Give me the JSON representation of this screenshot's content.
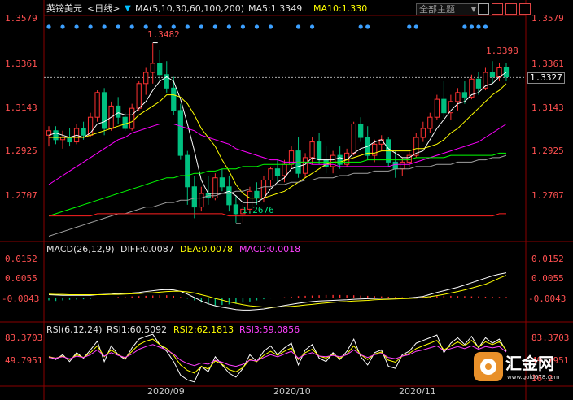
{
  "header": {
    "symbol": "英镑美元",
    "period_tab": "<日线>",
    "ma_label": "MA(5,10,30,60,100,200)",
    "ma5_label": "MA5:1.3349",
    "ma10_label": "MA10:1.330",
    "theme_select": "全部主题",
    "icons": [
      "square-grid-icon",
      "panel-icon",
      "single-panel-icon",
      "multi-panel-icon"
    ]
  },
  "price_panel": {
    "y_ticks": [
      "1.3579",
      "1.3361",
      "1.3143",
      "1.2925",
      "1.2707"
    ],
    "current_price": "1.3327",
    "high_label": "1.3482",
    "recent_high_label": "1.3398",
    "low_label": "1.2676"
  },
  "macd_panel": {
    "title": "MACD(26,12,9)",
    "diff": "DIFF:0.0087",
    "dea": "DEA:0.0078",
    "macd": "MACD:0.0018",
    "y_ticks": [
      "0.0152",
      "0.0055",
      "-0.0043"
    ]
  },
  "rsi_panel": {
    "title": "RSI(6,12,24)",
    "rsi1": "RSI1:60.5092",
    "rsi2": "RSI2:62.1813",
    "rsi3": "RSI3:59.0856",
    "y_ticks": [
      "83.3703",
      "49.7951"
    ],
    "y_tick_right_partial": "16.2"
  },
  "x_axis": {
    "labels": [
      "2020/09",
      "2020/10",
      "2020/11"
    ]
  },
  "watermark": {
    "name": "汇金网",
    "url": "www.gold678.com"
  },
  "colors": {
    "up": "#ff3232",
    "down": "#00c080",
    "ma5": "#ffffff",
    "ma10": "#ffff00",
    "ma30": "#ff00ff",
    "ma60": "#00ff00",
    "ma100": "#a0a0a0",
    "ma200": "#ff2020",
    "dots": "#3ca0ff"
  },
  "chart_data": {
    "type": "candlestick",
    "candles": [
      [
        1.307,
        1.311,
        1.302,
        1.309
      ],
      [
        1.309,
        1.311,
        1.303,
        1.305
      ],
      [
        1.305,
        1.309,
        1.301,
        1.306
      ],
      [
        1.306,
        1.31,
        1.302,
        1.304
      ],
      [
        1.304,
        1.312,
        1.303,
        1.31
      ],
      [
        1.31,
        1.313,
        1.305,
        1.307
      ],
      [
        1.307,
        1.317,
        1.306,
        1.315
      ],
      [
        1.315,
        1.327,
        1.313,
        1.326
      ],
      [
        1.326,
        1.328,
        1.307,
        1.31
      ],
      [
        1.31,
        1.322,
        1.309,
        1.32
      ],
      [
        1.32,
        1.324,
        1.312,
        1.315
      ],
      [
        1.315,
        1.317,
        1.309,
        1.31
      ],
      [
        1.31,
        1.321,
        1.309,
        1.319
      ],
      [
        1.319,
        1.331,
        1.318,
        1.33
      ],
      [
        1.33,
        1.337,
        1.325,
        1.335
      ],
      [
        1.335,
        1.348,
        1.33,
        1.339
      ],
      [
        1.339,
        1.345,
        1.331,
        1.334
      ],
      [
        1.334,
        1.34,
        1.326,
        1.328
      ],
      [
        1.328,
        1.333,
        1.316,
        1.318
      ],
      [
        1.318,
        1.321,
        1.296,
        1.298
      ],
      [
        1.298,
        1.3,
        1.276,
        1.284
      ],
      [
        1.284,
        1.289,
        1.27,
        1.275
      ],
      [
        1.275,
        1.284,
        1.273,
        1.281
      ],
      [
        1.281,
        1.289,
        1.276,
        1.279
      ],
      [
        1.279,
        1.29,
        1.278,
        1.288
      ],
      [
        1.288,
        1.292,
        1.282,
        1.284
      ],
      [
        1.284,
        1.289,
        1.273,
        1.276
      ],
      [
        1.276,
        1.28,
        1.268,
        1.272
      ],
      [
        1.272,
        1.276,
        1.268,
        1.274
      ],
      [
        1.274,
        1.284,
        1.272,
        1.282
      ],
      [
        1.282,
        1.286,
        1.276,
        1.279
      ],
      [
        1.279,
        1.289,
        1.277,
        1.287
      ],
      [
        1.287,
        1.293,
        1.284,
        1.292
      ],
      [
        1.292,
        1.296,
        1.286,
        1.289
      ],
      [
        1.289,
        1.296,
        1.286,
        1.294
      ],
      [
        1.294,
        1.302,
        1.292,
        1.3
      ],
      [
        1.3,
        1.306,
        1.288,
        1.29
      ],
      [
        1.29,
        1.299,
        1.288,
        1.297
      ],
      [
        1.297,
        1.306,
        1.294,
        1.304
      ],
      [
        1.304,
        1.308,
        1.294,
        1.296
      ],
      [
        1.296,
        1.302,
        1.29,
        1.293
      ],
      [
        1.293,
        1.3,
        1.29,
        1.298
      ],
      [
        1.298,
        1.302,
        1.292,
        1.294
      ],
      [
        1.294,
        1.301,
        1.293,
        1.299
      ],
      [
        1.299,
        1.313,
        1.298,
        1.312
      ],
      [
        1.312,
        1.315,
        1.304,
        1.306
      ],
      [
        1.306,
        1.311,
        1.296,
        1.298
      ],
      [
        1.298,
        1.305,
        1.295,
        1.303
      ],
      [
        1.303,
        1.307,
        1.3,
        1.305
      ],
      [
        1.305,
        1.306,
        1.293,
        1.295
      ],
      [
        1.295,
        1.3,
        1.288,
        1.292
      ],
      [
        1.292,
        1.297,
        1.289,
        1.295
      ],
      [
        1.295,
        1.3,
        1.293,
        1.298
      ],
      [
        1.298,
        1.308,
        1.297,
        1.306
      ],
      [
        1.306,
        1.313,
        1.304,
        1.31
      ],
      [
        1.31,
        1.317,
        1.308,
        1.315
      ],
      [
        1.315,
        1.325,
        1.314,
        1.323
      ],
      [
        1.323,
        1.331,
        1.315,
        1.317
      ],
      [
        1.317,
        1.325,
        1.314,
        1.322
      ],
      [
        1.322,
        1.328,
        1.318,
        1.326
      ],
      [
        1.326,
        1.331,
        1.321,
        1.324
      ],
      [
        1.324,
        1.334,
        1.323,
        1.332
      ],
      [
        1.332,
        1.335,
        1.325,
        1.328
      ],
      [
        1.328,
        1.337,
        1.327,
        1.335
      ],
      [
        1.335,
        1.34,
        1.33,
        1.333
      ],
      [
        1.333,
        1.339,
        1.331,
        1.337
      ],
      [
        1.337,
        1.339,
        1.331,
        1.333
      ]
    ],
    "ma_series": [
      {
        "name": "MA5",
        "values": [
          1.307,
          1.308,
          1.307,
          1.306,
          1.307,
          1.306,
          1.308,
          1.312,
          1.313,
          1.315,
          1.317,
          1.316,
          1.316,
          1.319,
          1.322,
          1.327,
          1.331,
          1.333,
          1.331,
          1.323,
          1.312,
          1.3,
          1.287,
          1.281,
          1.281,
          1.281,
          1.282,
          1.28,
          1.277,
          1.277,
          1.277,
          1.279,
          1.283,
          1.286,
          1.288,
          1.292,
          1.293,
          1.294,
          1.297,
          1.296,
          1.296,
          1.296,
          1.297,
          1.296,
          1.299,
          1.301,
          1.302,
          1.304,
          1.305,
          1.301,
          1.299,
          1.297,
          1.297,
          1.299,
          1.3,
          1.305,
          1.31,
          1.314,
          1.318,
          1.321,
          1.322,
          1.325,
          1.326,
          1.329,
          1.33,
          1.333,
          1.335
        ]
      },
      {
        "name": "MA10",
        "values": [
          1.306,
          1.306,
          1.306,
          1.306,
          1.306,
          1.306,
          1.307,
          1.308,
          1.309,
          1.31,
          1.311,
          1.312,
          1.313,
          1.316,
          1.318,
          1.32,
          1.322,
          1.325,
          1.325,
          1.324,
          1.321,
          1.316,
          1.31,
          1.306,
          1.302,
          1.296,
          1.291,
          1.285,
          1.281,
          1.279,
          1.279,
          1.279,
          1.28,
          1.281,
          1.282,
          1.284,
          1.286,
          1.288,
          1.29,
          1.292,
          1.294,
          1.295,
          1.295,
          1.296,
          1.297,
          1.298,
          1.299,
          1.299,
          1.3,
          1.3,
          1.3,
          1.3,
          1.3,
          1.301,
          1.301,
          1.302,
          1.303,
          1.305,
          1.308,
          1.31,
          1.313,
          1.316,
          1.319,
          1.322,
          1.325,
          1.327,
          1.33
        ]
      },
      {
        "name": "MA30",
        "values": [
          1.285,
          1.287,
          1.289,
          1.291,
          1.293,
          1.295,
          1.297,
          1.299,
          1.301,
          1.303,
          1.305,
          1.306,
          1.308,
          1.309,
          1.31,
          1.311,
          1.312,
          1.312,
          1.312,
          1.311,
          1.31,
          1.309,
          1.307,
          1.306,
          1.305,
          1.304,
          1.303,
          1.301,
          1.3,
          1.299,
          1.298,
          1.297,
          1.296,
          1.296,
          1.295,
          1.295,
          1.295,
          1.295,
          1.294,
          1.294,
          1.294,
          1.294,
          1.293,
          1.293,
          1.293,
          1.293,
          1.293,
          1.293,
          1.293,
          1.293,
          1.294,
          1.294,
          1.294,
          1.295,
          1.296,
          1.297,
          1.298,
          1.299,
          1.3,
          1.301,
          1.302,
          1.303,
          1.304,
          1.306,
          1.308,
          1.31,
          1.312
        ]
      },
      {
        "name": "MA60",
        "values": [
          1.271,
          1.272,
          1.273,
          1.274,
          1.275,
          1.276,
          1.277,
          1.278,
          1.279,
          1.28,
          1.281,
          1.282,
          1.283,
          1.284,
          1.285,
          1.286,
          1.287,
          1.288,
          1.288,
          1.289,
          1.289,
          1.29,
          1.29,
          1.291,
          1.291,
          1.292,
          1.292,
          1.292,
          1.293,
          1.293,
          1.293,
          1.294,
          1.294,
          1.294,
          1.294,
          1.294,
          1.295,
          1.295,
          1.295,
          1.295,
          1.295,
          1.295,
          1.295,
          1.295,
          1.295,
          1.295,
          1.296,
          1.296,
          1.296,
          1.296,
          1.296,
          1.296,
          1.296,
          1.297,
          1.297,
          1.297,
          1.297,
          1.297,
          1.298,
          1.298,
          1.298,
          1.298,
          1.298,
          1.298,
          1.298,
          1.299,
          1.299
        ]
      },
      {
        "name": "MA100",
        "values": [
          1.262,
          1.263,
          1.264,
          1.265,
          1.266,
          1.267,
          1.268,
          1.269,
          1.27,
          1.271,
          1.272,
          1.272,
          1.273,
          1.274,
          1.275,
          1.275,
          1.276,
          1.277,
          1.277,
          1.278,
          1.278,
          1.279,
          1.279,
          1.28,
          1.28,
          1.281,
          1.281,
          1.282,
          1.282,
          1.283,
          1.283,
          1.284,
          1.284,
          1.285,
          1.285,
          1.286,
          1.286,
          1.287,
          1.287,
          1.288,
          1.288,
          1.288,
          1.289,
          1.289,
          1.29,
          1.29,
          1.29,
          1.291,
          1.291,
          1.291,
          1.292,
          1.292,
          1.292,
          1.293,
          1.293,
          1.293,
          1.294,
          1.294,
          1.294,
          1.295,
          1.295,
          1.295,
          1.296,
          1.296,
          1.297,
          1.297,
          1.298
        ]
      },
      {
        "name": "MA200",
        "values": [
          1.271,
          1.271,
          1.271,
          1.271,
          1.271,
          1.271,
          1.271,
          1.272,
          1.272,
          1.272,
          1.272,
          1.272,
          1.272,
          1.272,
          1.272,
          1.272,
          1.272,
          1.272,
          1.272,
          1.272,
          1.272,
          1.272,
          1.272,
          1.272,
          1.272,
          1.272,
          1.271,
          1.271,
          1.271,
          1.271,
          1.271,
          1.271,
          1.271,
          1.271,
          1.271,
          1.271,
          1.271,
          1.271,
          1.271,
          1.271,
          1.271,
          1.271,
          1.271,
          1.271,
          1.271,
          1.271,
          1.271,
          1.271,
          1.271,
          1.271,
          1.271,
          1.271,
          1.271,
          1.271,
          1.271,
          1.271,
          1.271,
          1.271,
          1.271,
          1.271,
          1.271,
          1.271,
          1.271,
          1.271,
          1.271,
          1.272,
          1.272
        ]
      }
    ],
    "macd_hist": [
      -0.001,
      -0.0012,
      -0.001,
      -0.0008,
      -0.0007,
      -0.0006,
      -0.0005,
      -0.0003,
      -0.0002,
      0.0,
      0.0002,
      0.0003,
      0.0004,
      0.0005,
      0.0006,
      0.0007,
      0.0008,
      0.0008,
      0.0006,
      0.0002,
      -0.0004,
      -0.001,
      -0.0018,
      -0.0024,
      -0.0027,
      -0.0026,
      -0.0024,
      -0.0022,
      -0.0018,
      -0.0014,
      -0.001,
      -0.0006,
      -0.0003,
      -0.0001,
      0.0001,
      0.0003,
      0.0005,
      0.0006,
      0.0007,
      0.0008,
      0.0009,
      0.0009,
      0.0009,
      0.0008,
      0.0008,
      0.0007,
      0.0006,
      0.0005,
      0.0004,
      0.0003,
      0.0002,
      0.0001,
      0.0001,
      0.0002,
      0.0003,
      0.0004,
      0.0005,
      0.0006,
      0.0006,
      0.0005,
      0.0005,
      0.0004,
      0.0004,
      0.0003,
      0.0003,
      0.0002,
      0.0002
    ],
    "macd_diff": [
      0.001,
      0.0009,
      0.0008,
      0.0008,
      0.0008,
      0.0008,
      0.0008,
      0.001,
      0.0011,
      0.0012,
      0.0014,
      0.0015,
      0.0016,
      0.0018,
      0.0021,
      0.0024,
      0.0027,
      0.0028,
      0.0027,
      0.0022,
      0.0012,
      0.0,
      -0.0012,
      -0.0022,
      -0.0029,
      -0.0034,
      -0.0038,
      -0.0042,
      -0.0044,
      -0.0044,
      -0.0042,
      -0.004,
      -0.0036,
      -0.0032,
      -0.0028,
      -0.0024,
      -0.002,
      -0.0017,
      -0.0014,
      -0.0012,
      -0.0011,
      -0.001,
      -0.0009,
      -0.0008,
      -0.0006,
      -0.0005,
      -0.0004,
      -0.0003,
      -0.0002,
      -0.0002,
      -0.0002,
      -0.0002,
      -0.0001,
      0.0001,
      0.0004,
      0.0011,
      0.0018,
      0.0024,
      0.003,
      0.0036,
      0.0044,
      0.0052,
      0.006,
      0.0068,
      0.0076,
      0.0082,
      0.0087
    ],
    "macd_dea": [
      0.0012,
      0.0011,
      0.0011,
      0.001,
      0.001,
      0.001,
      0.001,
      0.001,
      0.001,
      0.0011,
      0.0011,
      0.0012,
      0.0013,
      0.0014,
      0.0016,
      0.0017,
      0.0019,
      0.0021,
      0.0022,
      0.0022,
      0.002,
      0.0016,
      0.001,
      0.0004,
      -0.0003,
      -0.0009,
      -0.0015,
      -0.002,
      -0.0025,
      -0.0029,
      -0.0031,
      -0.0033,
      -0.0034,
      -0.0033,
      -0.0032,
      -0.0031,
      -0.0029,
      -0.0026,
      -0.0024,
      -0.0021,
      -0.0019,
      -0.0017,
      -0.0015,
      -0.0014,
      -0.0012,
      -0.0011,
      -0.001,
      -0.0008,
      -0.0007,
      -0.0006,
      -0.0005,
      -0.0004,
      -0.0003,
      -0.0002,
      0.0,
      0.0003,
      0.0007,
      0.0011,
      0.0016,
      0.0021,
      0.0027,
      0.0033,
      0.004,
      0.0047,
      0.0057,
      0.0068,
      0.0078
    ],
    "rsi_series": [
      {
        "name": "RSI1",
        "values": [
          52,
          48,
          55,
          45,
          58,
          50,
          62,
          75,
          45,
          68,
          55,
          48,
          65,
          78,
          82,
          85,
          70,
          60,
          45,
          25,
          18,
          15,
          38,
          30,
          52,
          40,
          28,
          22,
          35,
          55,
          45,
          60,
          68,
          55,
          65,
          72,
          40,
          62,
          70,
          50,
          45,
          58,
          48,
          60,
          78,
          52,
          40,
          58,
          62,
          38,
          35,
          55,
          60,
          72,
          76,
          80,
          84,
          58,
          72,
          80,
          70,
          82,
          65,
          80,
          72,
          78,
          60
        ]
      },
      {
        "name": "RSI2",
        "values": [
          52,
          50,
          53,
          48,
          55,
          51,
          58,
          68,
          52,
          62,
          55,
          50,
          60,
          70,
          75,
          78,
          70,
          64,
          54,
          40,
          32,
          28,
          38,
          34,
          46,
          41,
          33,
          30,
          36,
          48,
          45,
          54,
          60,
          54,
          60,
          65,
          48,
          58,
          63,
          53,
          50,
          55,
          50,
          56,
          68,
          55,
          48,
          56,
          59,
          47,
          44,
          53,
          57,
          64,
          68,
          72,
          76,
          62,
          68,
          74,
          68,
          76,
          66,
          74,
          70,
          74,
          62
        ]
      },
      {
        "name": "RSI3",
        "values": [
          51,
          50,
          52,
          49,
          53,
          51,
          55,
          62,
          53,
          58,
          54,
          51,
          56,
          63,
          67,
          70,
          66,
          62,
          56,
          47,
          42,
          39,
          43,
          41,
          47,
          44,
          40,
          38,
          41,
          47,
          46,
          51,
          55,
          52,
          56,
          60,
          50,
          55,
          58,
          53,
          52,
          54,
          52,
          55,
          62,
          55,
          51,
          55,
          57,
          51,
          49,
          53,
          55,
          60,
          62,
          65,
          68,
          61,
          64,
          67,
          64,
          68,
          63,
          67,
          65,
          67,
          59
        ]
      }
    ],
    "ylim_price": [
      1.26,
      1.36
    ],
    "ylim_macd": [
      -0.008,
      0.016
    ],
    "ylim_rsi": [
      10,
      90
    ]
  }
}
